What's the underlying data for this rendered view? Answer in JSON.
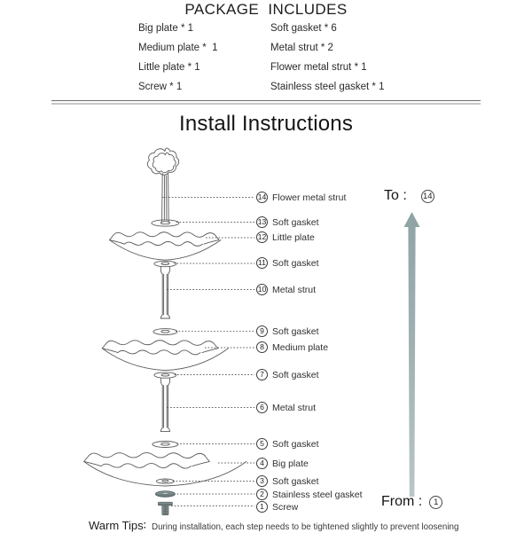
{
  "package": {
    "title": "PACKAGE  INCLUDES",
    "rows": [
      {
        "left": "Big plate * 1",
        "right": "Soft gasket * 6"
      },
      {
        "left": "Medium plate *  1",
        "right": "Metal strut * 2"
      },
      {
        "left": "Little plate * 1",
        "right": "Flower metal strut * 1"
      },
      {
        "left": "Screw * 1",
        "right": "Stainless steel gasket * 1"
      }
    ]
  },
  "install": {
    "title": "Install Instructions",
    "callouts": [
      {
        "num": "14",
        "label": "Flower metal strut"
      },
      {
        "num": "13",
        "label": "Soft gasket"
      },
      {
        "num": "12",
        "label": "Little plate"
      },
      {
        "num": "11",
        "label": "Soft gasket"
      },
      {
        "num": "10",
        "label": "Metal strut"
      },
      {
        "num": "9",
        "label": "Soft gasket"
      },
      {
        "num": "8",
        "label": "Medium plate"
      },
      {
        "num": "7",
        "label": "Soft gasket"
      },
      {
        "num": "6",
        "label": "Metal strut"
      },
      {
        "num": "5",
        "label": "Soft gasket"
      },
      {
        "num": "4",
        "label": "Big plate"
      },
      {
        "num": "3",
        "label": "Soft gasket"
      },
      {
        "num": "2",
        "label": "Stainless steel gasket"
      },
      {
        "num": "1",
        "label": "Screw"
      }
    ],
    "direction": {
      "to_label": "To :",
      "to_num": "14",
      "from_label": "From :",
      "from_num": "1"
    },
    "arrow_color": "#93a6a8"
  },
  "tips": {
    "head": "Warm Tips∶",
    "body": "During installation, each step needs to be tightened slightly to prevent loosening"
  }
}
